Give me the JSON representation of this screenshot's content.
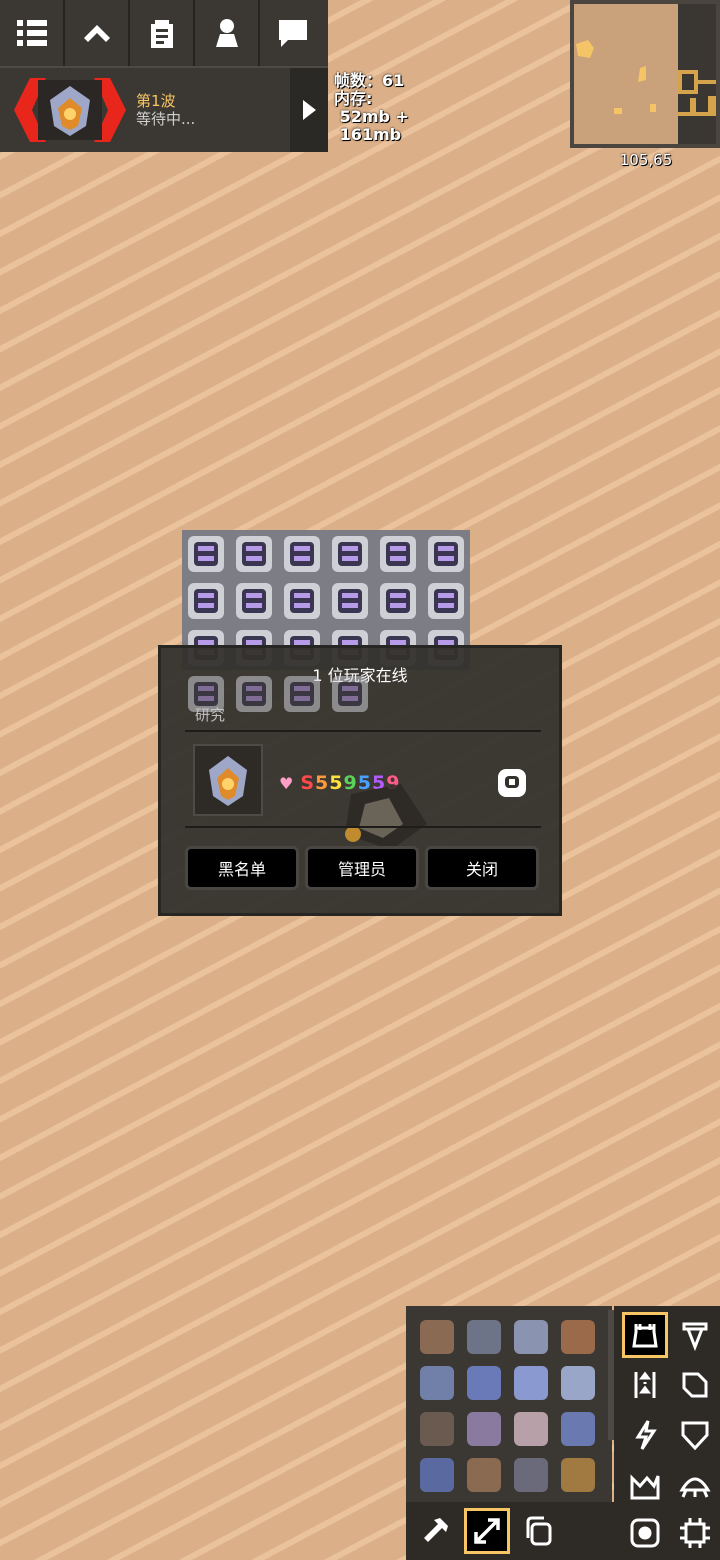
{
  "toolbar": {
    "buttons": [
      "menu",
      "up",
      "database",
      "players",
      "chat"
    ]
  },
  "wave": {
    "title": "第1波",
    "status": "等待中..."
  },
  "stats": {
    "fps_line": "帧数：61",
    "mem_label": "内存:",
    "mem_line1": " 52mb +",
    "mem_line2": " 161mb"
  },
  "minimap": {
    "coords": "105,65"
  },
  "dialog": {
    "title": "1 位玩家在线",
    "research_label": "研究",
    "player_name_chars": [
      "S",
      "5",
      "5",
      "9",
      "5",
      "5",
      "9"
    ],
    "player_name_colors": [
      "#ff4a4a",
      "#ff9a3c",
      "#ffe23c",
      "#5bd35b",
      "#4aa0ff",
      "#b25bff",
      "#ff5b8a"
    ],
    "buttons": {
      "blacklist": "黑名单",
      "admins": "管理员",
      "close": "关闭"
    }
  },
  "colors": {
    "accent": "#f7c563",
    "panel": "#3b3834",
    "sand": "#dbb089"
  },
  "build_categories": [
    "turret-icon",
    "production-icon",
    "distribution-icon",
    "liquid-icon",
    "power-icon",
    "defense-icon",
    "crafting-icon",
    "units-icon",
    "effect-icon",
    "logic-icon"
  ],
  "tools": [
    "hammer-icon",
    "expand-icon",
    "copy-icon"
  ]
}
